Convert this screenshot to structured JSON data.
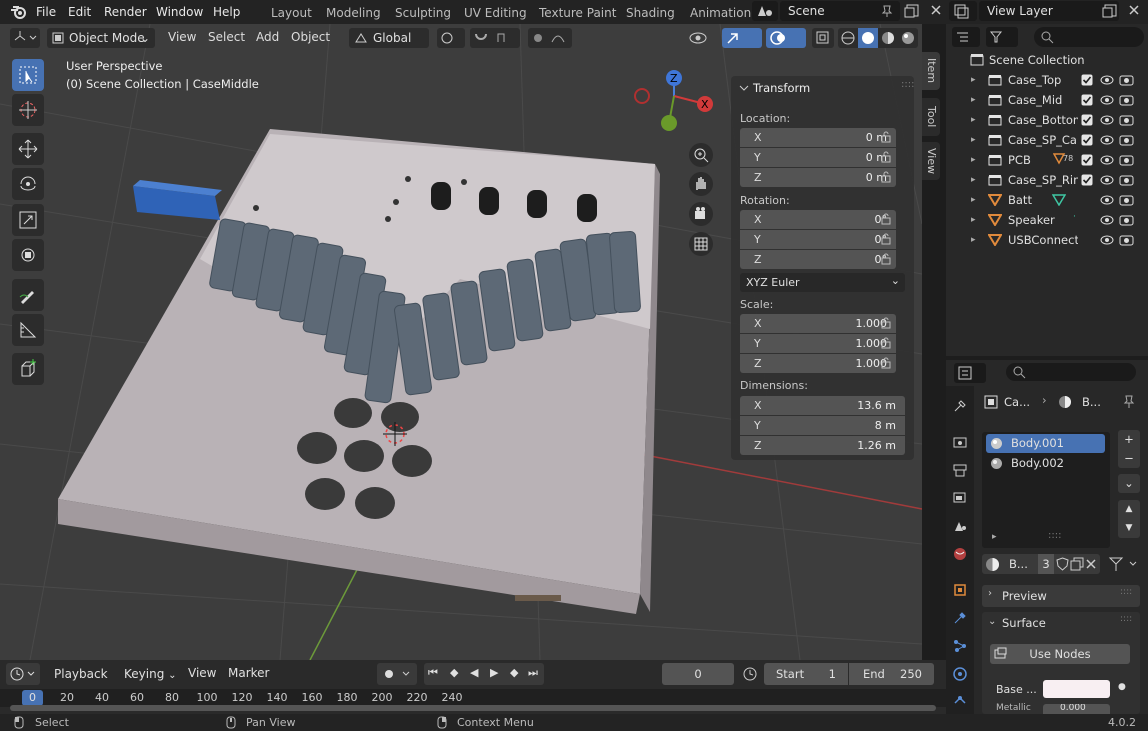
{
  "menubar": {
    "items": [
      "File",
      "Edit",
      "Render",
      "Window",
      "Help"
    ],
    "workspaces": [
      "Layout",
      "Modeling",
      "Sculpting",
      "UV Editing",
      "Texture Paint",
      "Shading",
      "Animation"
    ],
    "scene": "Scene",
    "view_layer": "View Layer"
  },
  "viewport_header": {
    "mode": "Object Mode",
    "view": "View",
    "select": "Select",
    "add": "Add",
    "object": "Object",
    "transform_orientation": "Global"
  },
  "viewport": {
    "perspective": "User Perspective",
    "collection_info": "(0) Scene Collection | CaseMiddle",
    "gizmo_axes": [
      "Z",
      "X",
      "Y"
    ]
  },
  "npanel": {
    "section": "Transform",
    "location_label": "Location:",
    "location": [
      {
        "axis": "X",
        "value": "0 m"
      },
      {
        "axis": "Y",
        "value": "0 m"
      },
      {
        "axis": "Z",
        "value": "0 m"
      }
    ],
    "rotation_label": "Rotation:",
    "rotation": [
      {
        "axis": "X",
        "value": "0°"
      },
      {
        "axis": "Y",
        "value": "0°"
      },
      {
        "axis": "Z",
        "value": "0°"
      }
    ],
    "rotation_mode": "XYZ Euler",
    "scale_label": "Scale:",
    "scale": [
      {
        "axis": "X",
        "value": "1.000"
      },
      {
        "axis": "Y",
        "value": "1.000"
      },
      {
        "axis": "Z",
        "value": "1.000"
      }
    ],
    "dimensions_label": "Dimensions:",
    "dimensions": [
      {
        "axis": "X",
        "value": "13.6 m"
      },
      {
        "axis": "Y",
        "value": "8 m"
      },
      {
        "axis": "Z",
        "value": "1.26 m"
      }
    ]
  },
  "side_tabs": [
    "Item",
    "Tool",
    "View"
  ],
  "outliner": {
    "root": "Scene Collection",
    "items": [
      {
        "name": "Case_Top",
        "type": "collection"
      },
      {
        "name": "Case_Mid",
        "type": "collection"
      },
      {
        "name": "Case_Bottom",
        "type": "collection"
      },
      {
        "name": "Case_SP_Cap",
        "type": "collection"
      },
      {
        "name": "PCB",
        "type": "collection",
        "badge": "78"
      },
      {
        "name": "Case_SP_Rin",
        "type": "collection"
      },
      {
        "name": "Batt",
        "type": "object"
      },
      {
        "name": "Speaker",
        "type": "object"
      },
      {
        "name": "USBConnecto",
        "type": "object"
      }
    ]
  },
  "properties": {
    "breadcrumb_obj": "Ca...",
    "breadcrumb_mat": "B...",
    "materials": [
      "Body.001",
      "Body.002"
    ],
    "material_name": "B...",
    "user_count": "3",
    "preview": "Preview",
    "surface": "Surface",
    "use_nodes": "Use Nodes",
    "base_label": "Base ...",
    "base_color": "#f8eff2",
    "metallic_label": "Metallic",
    "metallic_value": "0.000"
  },
  "timeline": {
    "playback": "Playback",
    "keying": "Keying",
    "view": "View",
    "marker": "Marker",
    "current_frame": "0",
    "start_label": "Start",
    "start": "1",
    "end_label": "End",
    "end": "250",
    "ruler": [
      "0",
      "20",
      "40",
      "60",
      "80",
      "100",
      "120",
      "140",
      "160",
      "180",
      "200",
      "220",
      "240"
    ]
  },
  "statusbar": {
    "select": "Select",
    "pan": "Pan View",
    "context": "Context Menu",
    "version": "4.0.2"
  },
  "colors": {
    "accent": "#4772b3",
    "active_field": "#4772b3",
    "object_orange": "#e08a3c",
    "collection": "#e6e6e6"
  }
}
